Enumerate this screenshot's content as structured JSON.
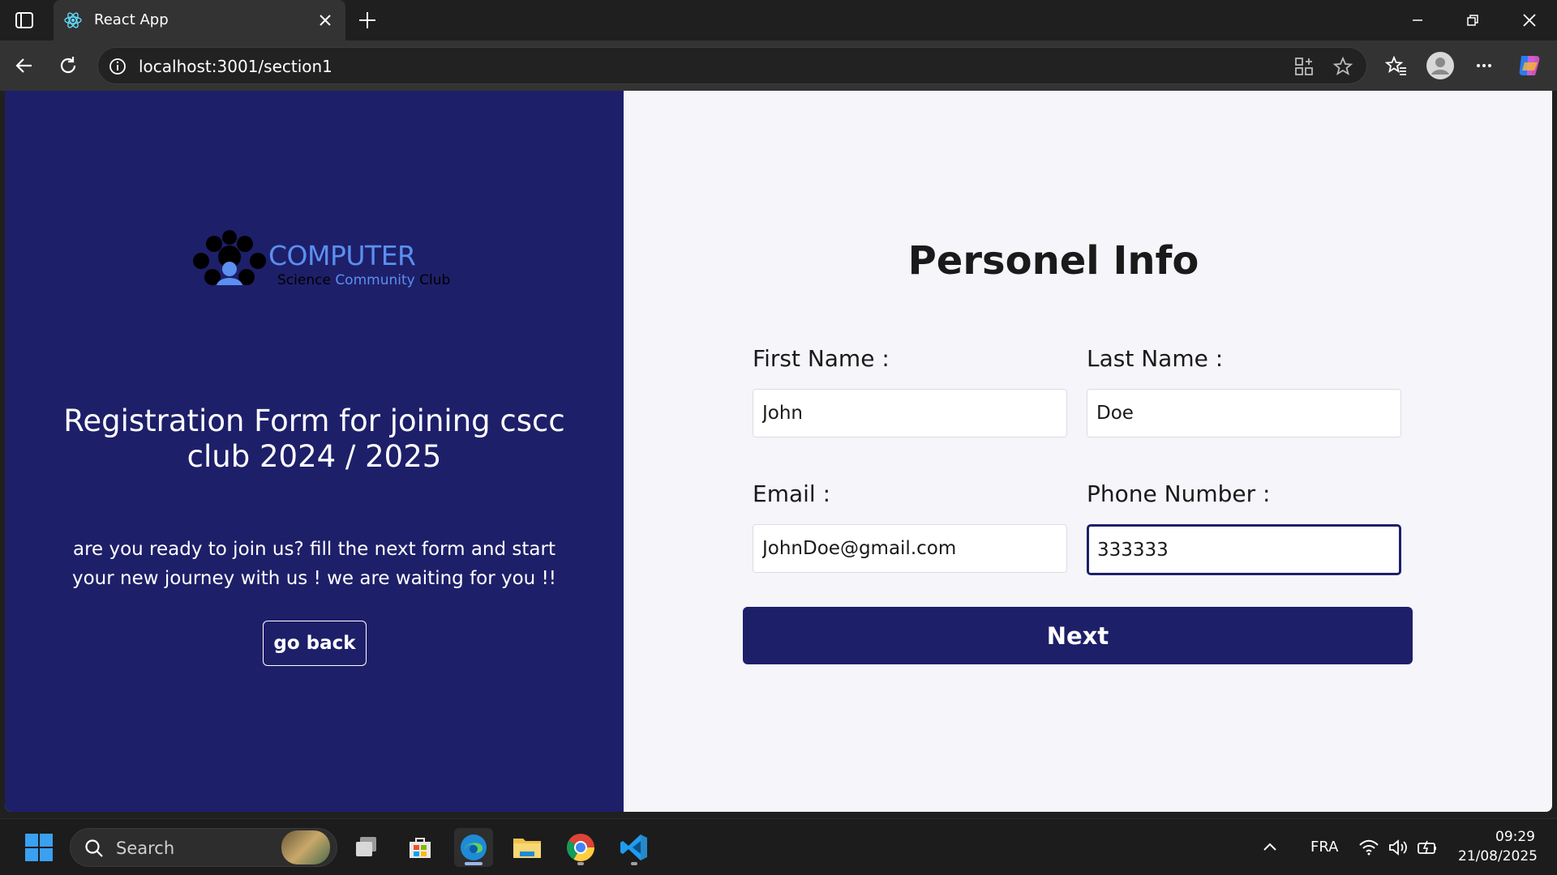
{
  "browser": {
    "tab_title": "React App",
    "url": "localhost:3001/section1"
  },
  "left_panel": {
    "logo": {
      "title": "COMPUTER",
      "sub_word1": "Science",
      "sub_word2": "Community",
      "sub_word3": "Club"
    },
    "heading": "Registration Form for joining cscc club 2024 / 2025",
    "description": "are you ready to join us? fill the next form and start your new journey with us ! we are waiting for you !!",
    "go_back_label": "go back"
  },
  "form": {
    "title": "Personel Info",
    "first_name": {
      "label": "First Name :",
      "value": "John"
    },
    "last_name": {
      "label": "Last Name :",
      "value": "Doe"
    },
    "email": {
      "label": "Email :",
      "value": "JohnDoe@gmail.com"
    },
    "phone": {
      "label": "Phone Number :",
      "value": "333333"
    },
    "next_label": "Next"
  },
  "taskbar": {
    "search_placeholder": "Search",
    "language": "FRA",
    "time": "09:29",
    "date": "21/08/2025"
  },
  "colors": {
    "primary": "#1e1f69",
    "logo_accent": "#5b8ff0",
    "page_bg": "#f5f5fa"
  }
}
